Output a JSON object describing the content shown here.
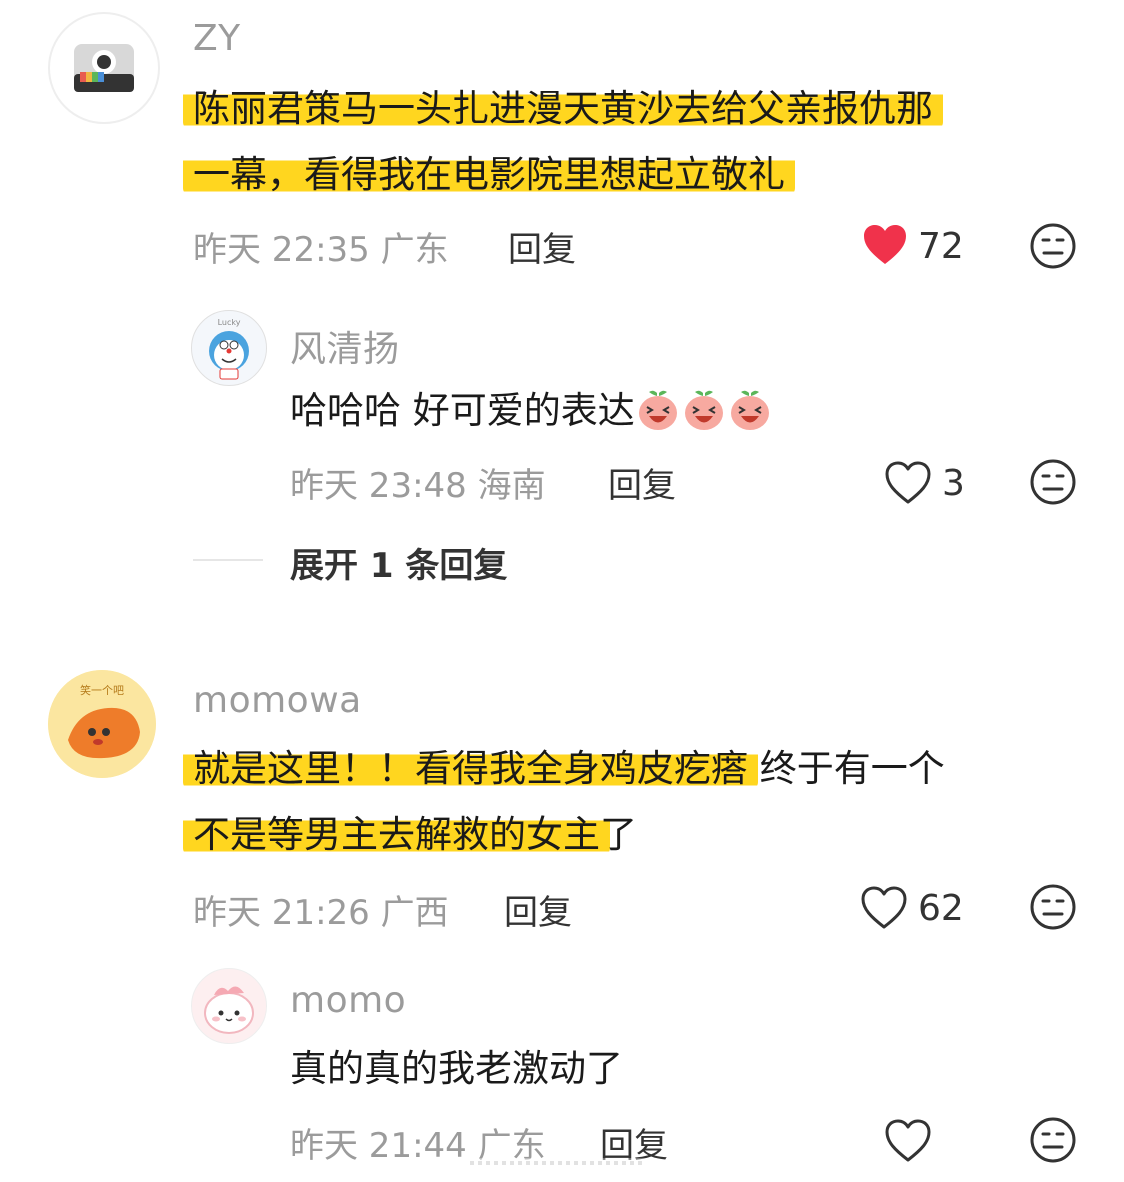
{
  "comments": [
    {
      "username": "ZY",
      "text_highlighted_line1": "陈丽君策马一头扎进漫天黄沙去给父亲报仇那",
      "text_highlighted_line2": "一幕，看得我在电影院里想起立敬礼",
      "time": "昨天 22:35 广东",
      "reply_label": "回复",
      "likes": "72",
      "liked": true,
      "like_icon": "heart-filled-icon",
      "dislike_icon": "neutral-face-icon",
      "colors": {
        "liked_heart": "#f0324b",
        "highlight": "#ffd000"
      },
      "replies": [
        {
          "username": "风清扬",
          "text": "哈哈哈  好可爱的表达",
          "emoji": "laughing-peach-emoji",
          "time": "昨天 23:48 海南",
          "reply_label": "回复",
          "likes": "3",
          "like_icon": "heart-outline-icon",
          "dislike_icon": "neutral-face-icon"
        }
      ],
      "expand_label": "展开 1 条回复"
    },
    {
      "username": "momowa",
      "text_highlighted_line1": "就是这里！！看得我全身鸡皮疙瘩",
      "text_plain_line1": " 终于有一个",
      "text_highlighted_line2": "不是等男主去解救的女主",
      "text_plain_line2": "了",
      "time": "昨天 21:26 广西",
      "reply_label": "回复",
      "likes": "62",
      "like_icon": "heart-outline-icon",
      "dislike_icon": "neutral-face-icon",
      "replies": [
        {
          "username": "momo",
          "text": "真的真的我老激动了",
          "time": "昨天 21:44 广东",
          "reply_label": "回复",
          "likes": "",
          "like_icon": "heart-outline-icon",
          "dislike_icon": "neutral-face-icon"
        }
      ]
    }
  ]
}
